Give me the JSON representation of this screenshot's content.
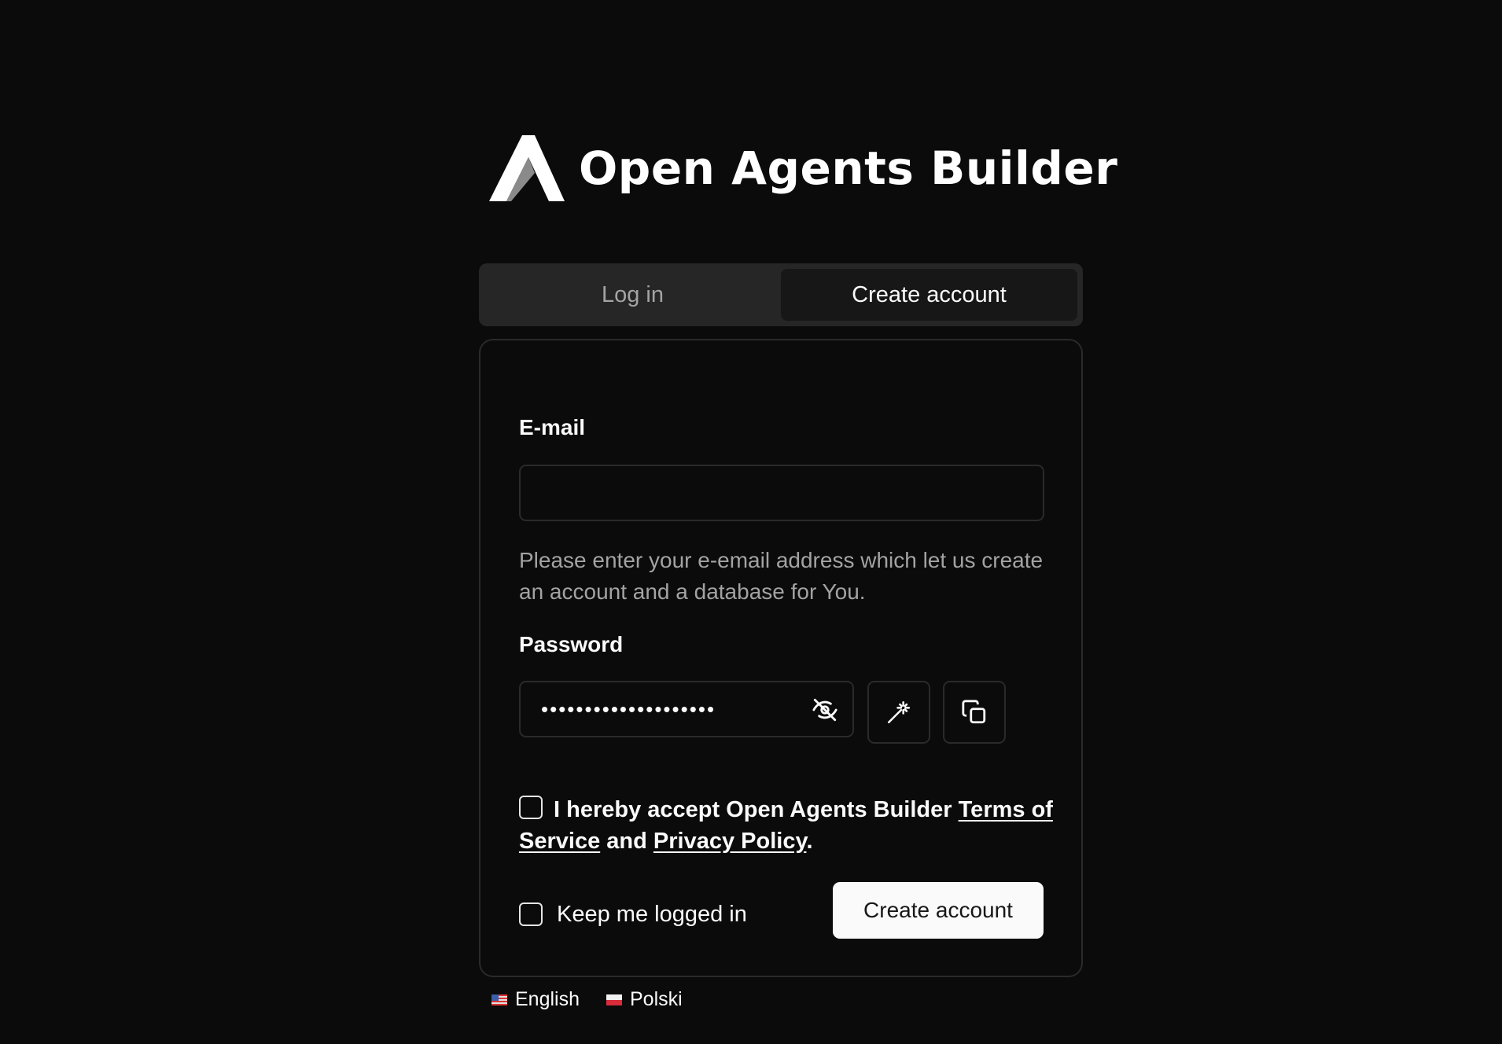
{
  "brand": {
    "name": "Open Agents Builder"
  },
  "tabs": [
    {
      "label": "Log in",
      "active": false
    },
    {
      "label": "Create account",
      "active": true
    }
  ],
  "form": {
    "email_label": "E-mail",
    "email_value": "",
    "email_help": "Please enter your e-email address which let us create an account and a database for You.",
    "password_label": "Password",
    "password_masked": "••••••••••••••••••••",
    "terms": {
      "prefix": "I hereby accept Open Agents Builder",
      "tos_link": "Terms of Service",
      "middle": "and",
      "privacy_link": "Privacy Policy",
      "suffix": "."
    },
    "keep_logged_in": "Keep me logged in",
    "submit": "Create account"
  },
  "languages": [
    {
      "label": "English",
      "flag": "us-flag-icon"
    },
    {
      "label": "Polski",
      "flag": "pl-flag-icon"
    }
  ],
  "colors": {
    "background": "#0b0b0b",
    "button": "#fafafa"
  },
  "icons": {
    "toggle_visibility": "eye-off-icon",
    "generate": "magic-wand-icon",
    "copy": "copy-icon"
  }
}
